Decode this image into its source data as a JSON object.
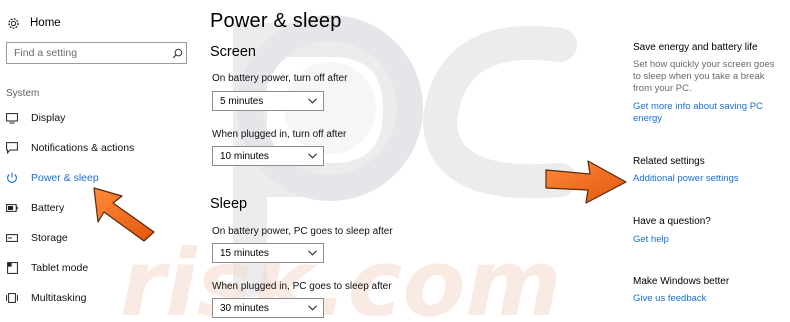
{
  "watermark": {
    "text": "PC risk.com"
  },
  "sidebar": {
    "home_label": "Home",
    "search": {
      "placeholder": "Find a setting"
    },
    "section_label": "System",
    "items": [
      {
        "label": "Display",
        "icon": "display-icon"
      },
      {
        "label": "Notifications & actions",
        "icon": "notifications-icon"
      },
      {
        "label": "Power & sleep",
        "icon": "power-icon",
        "active": true
      },
      {
        "label": "Battery",
        "icon": "battery-icon"
      },
      {
        "label": "Storage",
        "icon": "storage-icon"
      },
      {
        "label": "Tablet mode",
        "icon": "tablet-mode-icon"
      },
      {
        "label": "Multitasking",
        "icon": "multitasking-icon"
      }
    ]
  },
  "main": {
    "title": "Power & sleep",
    "screen": {
      "heading": "Screen",
      "battery_label": "On battery power, turn off after",
      "battery_value": "5 minutes",
      "plugged_label": "When plugged in, turn off after",
      "plugged_value": "10 minutes"
    },
    "sleep": {
      "heading": "Sleep",
      "battery_label": "On battery power, PC goes to sleep after",
      "battery_value": "15 minutes",
      "plugged_label": "When plugged in, PC goes to sleep after",
      "plugged_value": "30 minutes"
    }
  },
  "right": {
    "save_energy_heading": "Save energy and battery life",
    "save_energy_text": "Set how quickly your screen goes to sleep when you take a break from your PC.",
    "save_energy_link": "Get more info about saving PC energy",
    "related_heading": "Related settings",
    "related_link": "Additional power settings",
    "question_heading": "Have a question?",
    "help_link": "Get help",
    "better_heading": "Make Windows better",
    "feedback_link": "Give us feedback"
  },
  "colors": {
    "accent": "#1a6fd1",
    "arrow": "#f26a1b",
    "watermark": "#e4e4e4"
  }
}
